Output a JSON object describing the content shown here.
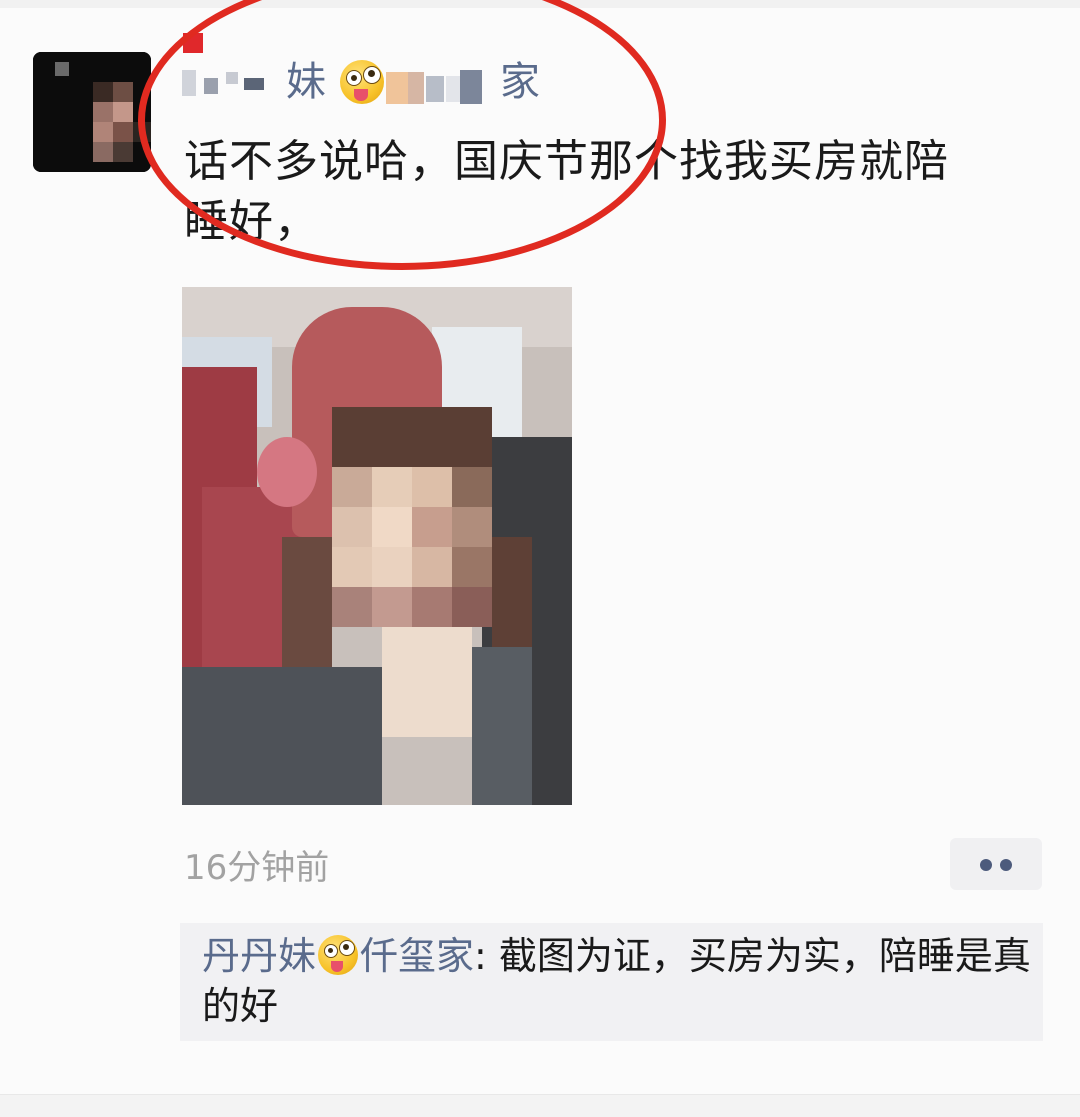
{
  "post": {
    "username_visible_chars": [
      "妹",
      "家"
    ],
    "text_line1": "话不多说哈，国庆节那个找我买房就陪",
    "text_line2": "睡好，",
    "timestamp": "16分钟前",
    "more_label": "••"
  },
  "comment": {
    "commenter_part1": "丹丹妹",
    "commenter_part2": "仟玺家",
    "separator": ": ",
    "text": "截图为证，买房为实，陪睡是真的好"
  },
  "colors": {
    "link_blue": "#5a6b8c",
    "annotation_red": "#e02a20",
    "text": "#1a1a1a",
    "timestamp_gray": "#a2a2a2"
  },
  "icons": {
    "emoji": "zany-face-emoji",
    "more": "more-dots-icon"
  }
}
